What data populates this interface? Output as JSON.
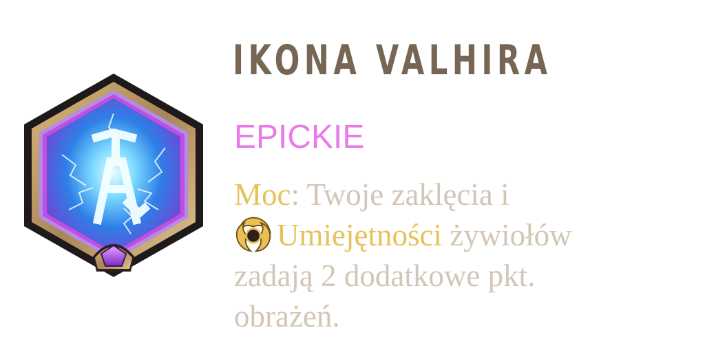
{
  "item": {
    "name": "IKONA VALHIRA",
    "rarity": "EPICKIE",
    "description": {
      "line1": {
        "label": "Moc",
        "sep": ":",
        "text": " Twoje zaklęcia i"
      },
      "line2": {
        "icon": "elemental-swirl-icon",
        "keyword": "Umiejętności",
        "text": " żywiołów"
      },
      "line3": "zadają 2 dodatkowe pkt.",
      "line4": "obrażeń."
    },
    "emblem_icon": "valhir-rune-emblem-icon",
    "gem_icon": "purple-pentagon-gem-icon"
  },
  "colors": {
    "title": "#766653",
    "rarity": "#e97be9",
    "keyword": "#e6c25b",
    "description": "#d2c6b6"
  }
}
